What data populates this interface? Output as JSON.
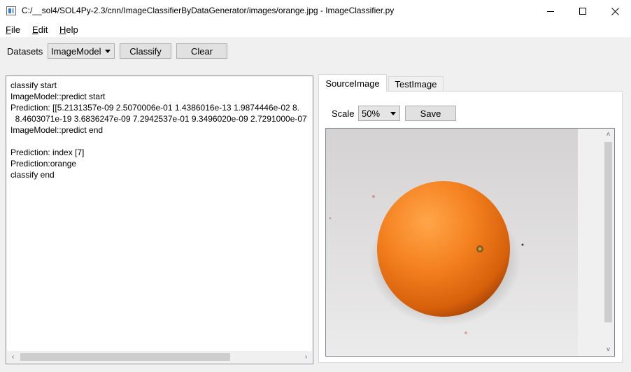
{
  "window": {
    "title": "C:/__sol4/SOL4Py-2.3/cnn/ImageClassifierByDataGenerator/images/orange.jpg - ImageClassifier.py",
    "controls": {
      "minimize": "—",
      "maximize": "☐",
      "close": "✕"
    }
  },
  "menu": {
    "items": [
      {
        "mnemonic": "F",
        "rest": "ile"
      },
      {
        "mnemonic": "E",
        "rest": "dit"
      },
      {
        "mnemonic": "H",
        "rest": "elp"
      }
    ]
  },
  "toolbar": {
    "datasets_label": "Datasets",
    "datasets_selected": "ImageModel",
    "classify_label": "Classify",
    "clear_label": "Clear"
  },
  "output": {
    "lines": [
      "classify start",
      "ImageModel::predict start",
      "Prediction: [[5.2131357e-09 2.5070006e-01 1.4386016e-13 1.9874446e-02 8.",
      "  8.4603071e-19 3.6836247e-09 7.2942537e-01 9.3496020e-09 2.7291000e-07",
      "ImageModel::predict end",
      "",
      "Prediction: index [7]",
      "Prediction:orange",
      "classify end"
    ]
  },
  "tabs": [
    {
      "label": "SourceImage",
      "active": true
    },
    {
      "label": "TestImage",
      "active": false
    }
  ],
  "image_panel": {
    "scale_label": "Scale",
    "scale_selected": "50%",
    "save_label": "Save"
  },
  "icons": {
    "scroll_left": "‹",
    "scroll_right": "›",
    "scroll_up": "˄",
    "scroll_down": "˅"
  },
  "colors": {
    "window_bg": "#f0f0f0",
    "orange": "#f07a14",
    "photo_bg": "#dcdcdc"
  }
}
